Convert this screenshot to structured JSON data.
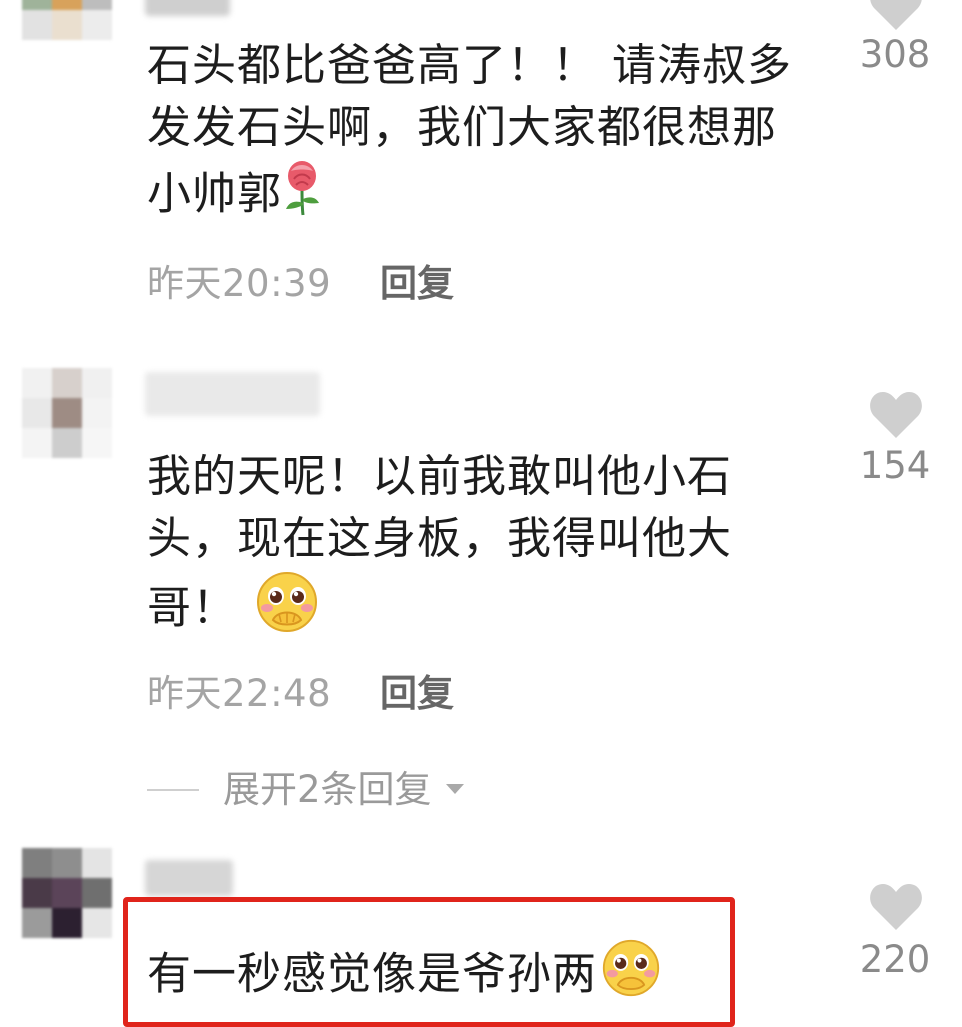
{
  "colors": {
    "highlight": "#e0241b",
    "like_icon": "#cfcfcf",
    "meta_text": "#a4a4a4"
  },
  "comments": [
    {
      "lines": [
        "石头都比爸爸高了！！ 请涛叔多",
        "发发石头啊，我们大家都很想那",
        "小帅郭"
      ],
      "emoji": "rose-icon",
      "time": "昨天20:39",
      "reply_label": "回复",
      "likes": "308"
    },
    {
      "lines": [
        "我的天呢！以前我敢叫他小石",
        "头，现在这身板，我得叫他大",
        "哥！"
      ],
      "emoji": "shy-face-icon",
      "time": "昨天22:48",
      "reply_label": "回复",
      "likes": "154",
      "expand_label": "展开2条回复"
    },
    {
      "lines": [
        "有一秒感觉像是爷孙两"
      ],
      "emoji": "shy-face-icon",
      "likes": "220",
      "highlighted": true
    }
  ]
}
